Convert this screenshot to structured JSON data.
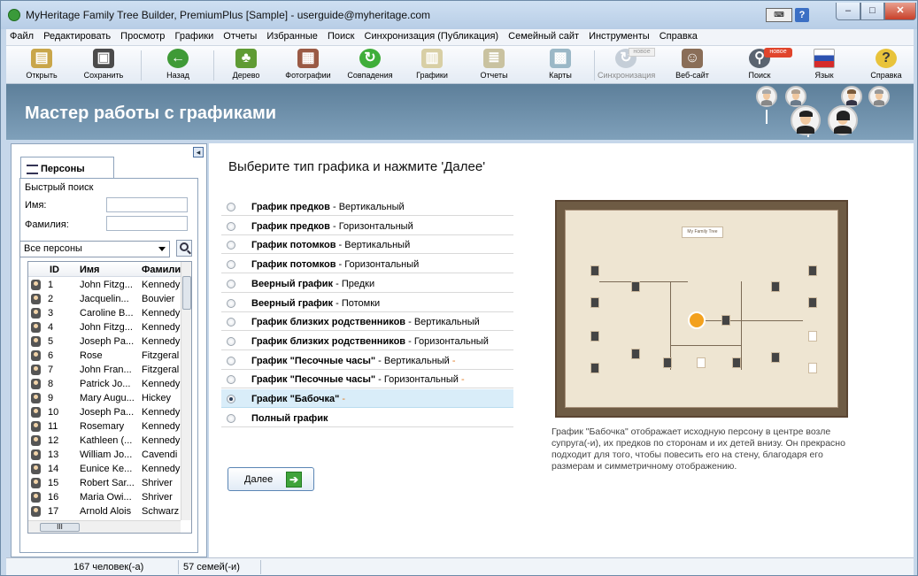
{
  "window": {
    "title": "MyHeritage Family Tree Builder, PremiumPlus [Sample] - userguide@myheritage.com"
  },
  "menu": [
    "Файл",
    "Редактировать",
    "Просмотр",
    "Графики",
    "Отчеты",
    "Избранные",
    "Поиск",
    "Синхронизация (Публикация)",
    "Семейный сайт",
    "Инструменты",
    "Справка"
  ],
  "toolbar": {
    "open": "Открыть",
    "save": "Сохранить",
    "back": "Назад",
    "tree": "Дерево",
    "photos": "Фотографии",
    "matches": "Совпадения",
    "charts": "Графики",
    "reports": "Отчеты",
    "maps": "Карты",
    "sync": "Синхронизация",
    "website": "Веб-сайт",
    "search": "Поиск",
    "language": "Язык",
    "help": "Справка",
    "new_badge": "новое"
  },
  "banner": {
    "title": "Мастер работы с графиками"
  },
  "left": {
    "tab": "Персоны",
    "quick_search": "Быстрый поиск",
    "name_label": "Имя:",
    "surname_label": "Фамилия:",
    "filter": "Все персоны",
    "columns": [
      "ID",
      "Имя",
      "Фамили"
    ],
    "rows": [
      {
        "id": "1",
        "name": "John Fitzg...",
        "surname": "Kennedy"
      },
      {
        "id": "2",
        "name": "Jacquelin...",
        "surname": "Bouvier"
      },
      {
        "id": "3",
        "name": "Caroline B...",
        "surname": "Kennedy"
      },
      {
        "id": "4",
        "name": "John Fitzg...",
        "surname": "Kennedy"
      },
      {
        "id": "5",
        "name": "Joseph Pa...",
        "surname": "Kennedy"
      },
      {
        "id": "6",
        "name": "Rose",
        "surname": "Fitzgeral"
      },
      {
        "id": "7",
        "name": "John Fran...",
        "surname": "Fitzgeral"
      },
      {
        "id": "8",
        "name": "Patrick Jo...",
        "surname": "Kennedy"
      },
      {
        "id": "9",
        "name": "Mary Augu...",
        "surname": "Hickey"
      },
      {
        "id": "10",
        "name": "Joseph Pa...",
        "surname": "Kennedy"
      },
      {
        "id": "11",
        "name": "Rosemary",
        "surname": "Kennedy"
      },
      {
        "id": "12",
        "name": "Kathleen (...",
        "surname": "Kennedy"
      },
      {
        "id": "13",
        "name": "William Jo...",
        "surname": "Cavendi"
      },
      {
        "id": "14",
        "name": "Eunice Ke...",
        "surname": "Kennedy"
      },
      {
        "id": "15",
        "name": "Robert Sar...",
        "surname": "Shriver"
      },
      {
        "id": "16",
        "name": "Maria Owi...",
        "surname": "Shriver"
      },
      {
        "id": "17",
        "name": "Arnold Alois",
        "surname": "Schwarz"
      }
    ]
  },
  "main": {
    "question": "Выберите тип графика и нажмите 'Далее'",
    "options": [
      {
        "bold": "График предков",
        "rest": " - Вертикальный",
        "selected": false
      },
      {
        "bold": "График предков",
        "rest": " - Горизонтальный",
        "selected": false
      },
      {
        "bold": "График потомков",
        "rest": " - Вертикальный",
        "selected": false
      },
      {
        "bold": "График потомков",
        "rest": " - Горизонтальный",
        "selected": false
      },
      {
        "bold": "Веерный график",
        "rest": " - Предки",
        "selected": false
      },
      {
        "bold": "Веерный график",
        "rest": " - Потомки",
        "selected": false
      },
      {
        "bold": "График близких родственников",
        "rest": " - Вертикальный",
        "selected": false
      },
      {
        "bold": "График близких родственников",
        "rest": " - Горизонтальный",
        "selected": false
      },
      {
        "bold": "График \"Песочные часы\"",
        "rest": " - Вертикальный",
        "dash": " -",
        "selected": false
      },
      {
        "bold": "График \"Песочные часы\"",
        "rest": " - Горизонтальный",
        "dash": " -",
        "selected": false
      },
      {
        "bold": "График \"Бабочка\"",
        "rest": "",
        "dash": " -",
        "selected": true
      },
      {
        "bold": "Полный график",
        "rest": "",
        "selected": false
      }
    ],
    "next_button": "Далее",
    "preview_title": "My Family Tree",
    "description": "График \"Бабочка\" отображает исходную персону в центре возле супруга(-и), их предков по сторонам и их детей внизу. Он прекрасно подходит для того, чтобы повесить его на стену, благодаря его размерам и симметричному отображению."
  },
  "status": {
    "persons": "167 человек(-а)",
    "families": "57 семей(-и)"
  },
  "colors": {
    "banner": "#6f92ad",
    "selected_row": "#d9edf9",
    "accent_dash": "#e07820"
  }
}
